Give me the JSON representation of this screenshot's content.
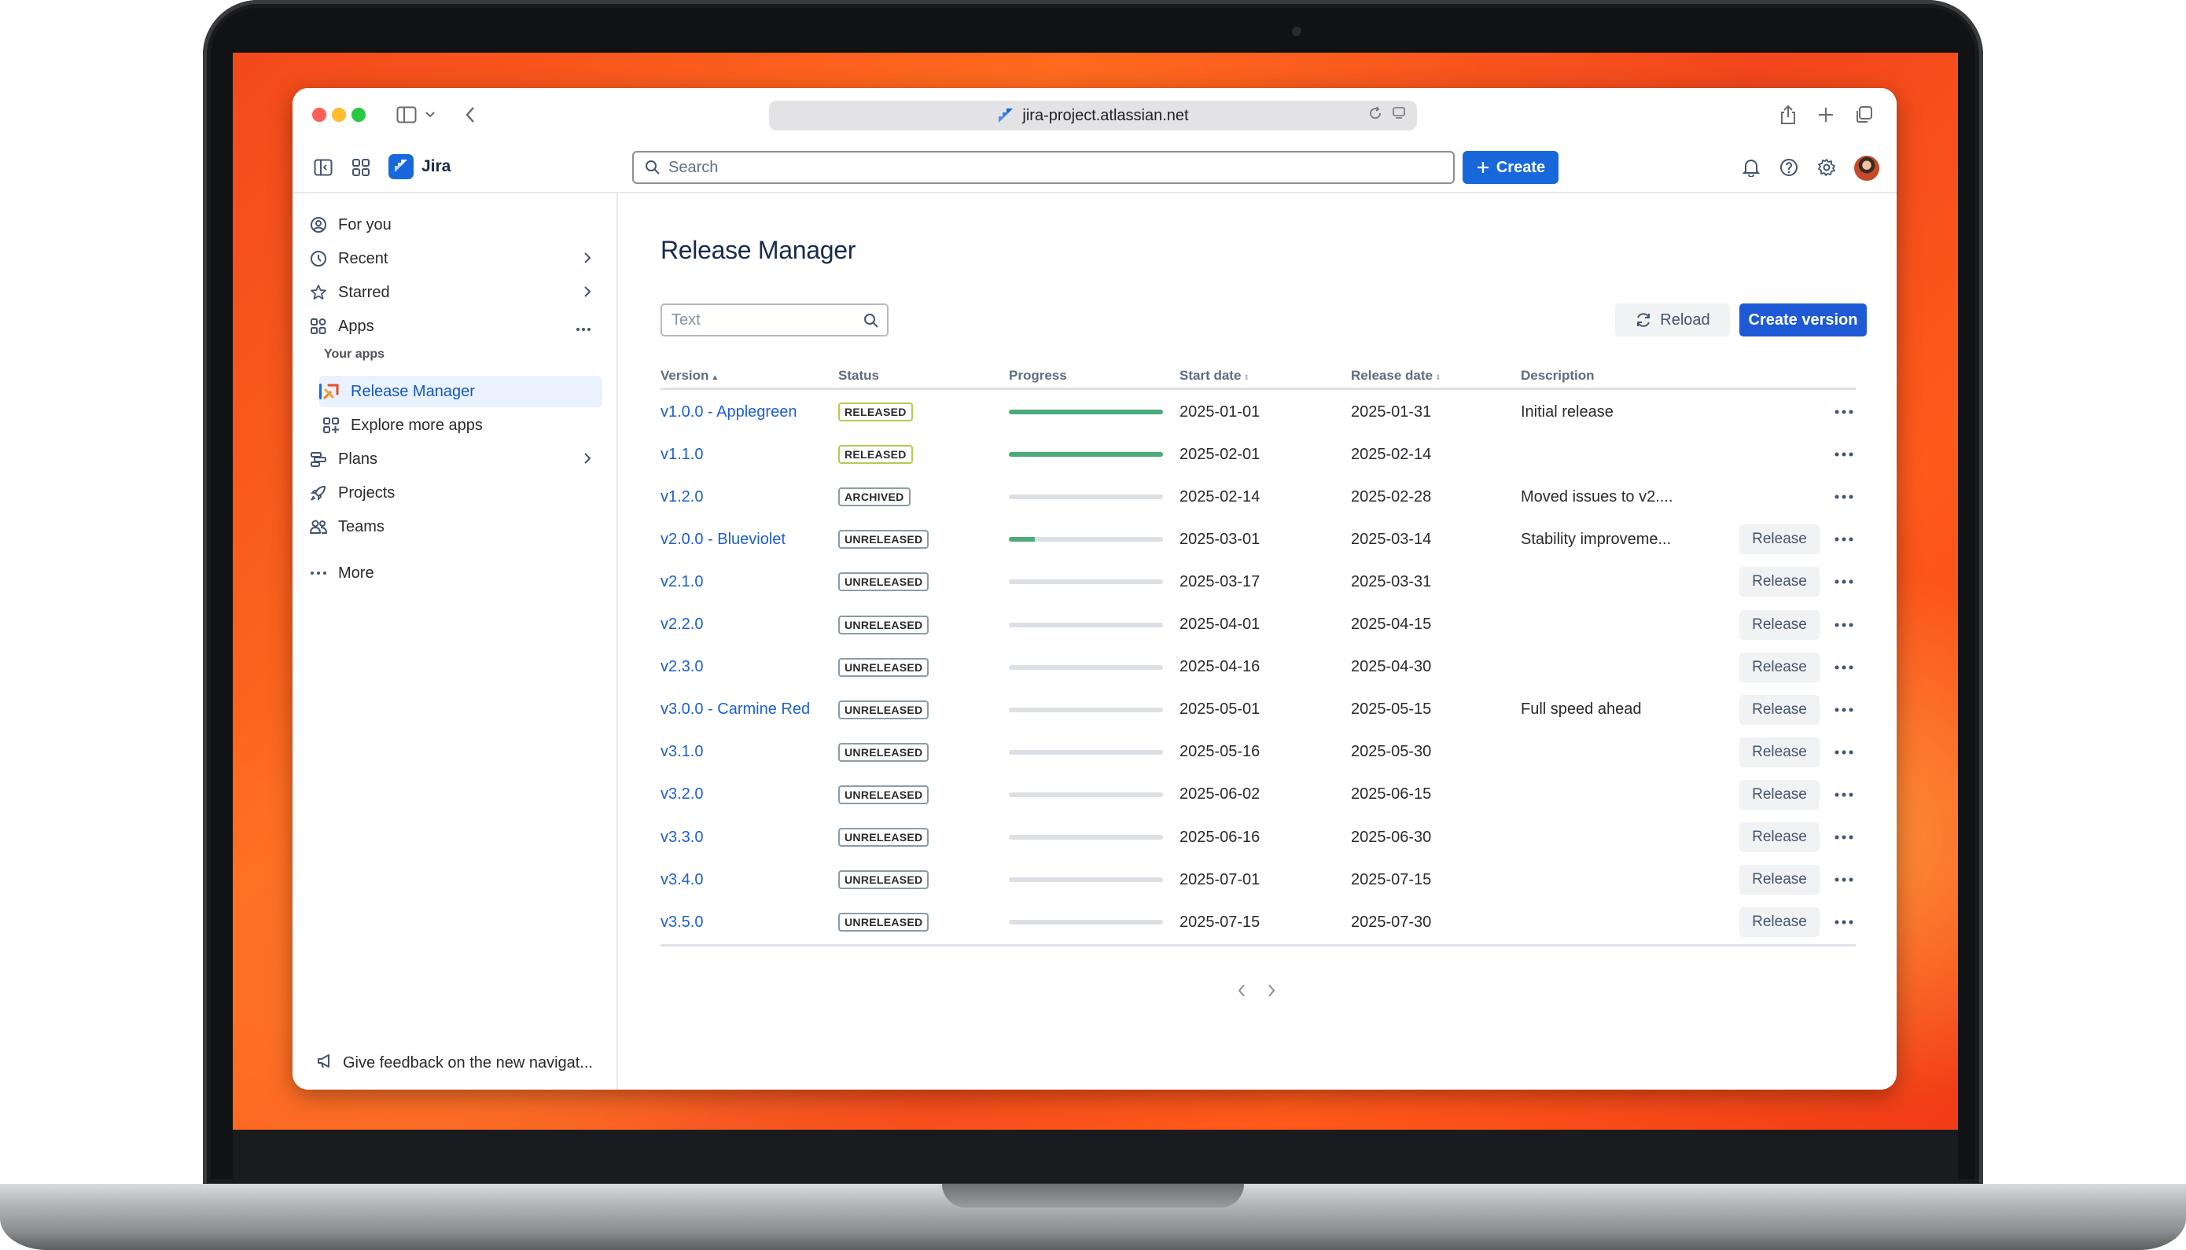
{
  "browser": {
    "url": "jira-project.atlassian.net"
  },
  "header": {
    "app_name": "Jira",
    "search_placeholder": "Search",
    "create_label": "Create"
  },
  "sidebar": {
    "items": [
      {
        "label": "For you",
        "icon": "user-circle-icon"
      },
      {
        "label": "Recent",
        "icon": "clock-icon"
      },
      {
        "label": "Starred",
        "icon": "star-icon"
      },
      {
        "label": "Apps",
        "icon": "apps-icon"
      }
    ],
    "your_apps_label": "Your apps",
    "app_items": [
      {
        "label": "Release Manager",
        "icon": "release-manager-icon",
        "active": true
      },
      {
        "label": "Explore more apps",
        "icon": "apps-add-icon"
      }
    ],
    "bottom_items": [
      {
        "label": "Plans",
        "icon": "plans-icon"
      },
      {
        "label": "Projects",
        "icon": "rocket-icon"
      },
      {
        "label": "Teams",
        "icon": "teams-icon"
      }
    ],
    "more_label": "More",
    "feedback_label": "Give feedback on the new navigat..."
  },
  "main": {
    "title": "Release Manager",
    "filter_placeholder": "Text",
    "reload_label": "Reload",
    "create_version_label": "Create version",
    "columns": {
      "version": "Version",
      "status": "Status",
      "progress": "Progress",
      "start_date": "Start date",
      "release_date": "Release date",
      "description": "Description"
    },
    "release_button_label": "Release",
    "rows": [
      {
        "version": "v1.0.0 - Applegreen",
        "status": "RELEASED",
        "progress": 1.0,
        "start": "2025-01-01",
        "release": "2025-01-31",
        "description": "Initial release",
        "show_release": false
      },
      {
        "version": "v1.1.0",
        "status": "RELEASED",
        "progress": 1.0,
        "start": "2025-02-01",
        "release": "2025-02-14",
        "description": "",
        "show_release": false
      },
      {
        "version": "v1.2.0",
        "status": "ARCHIVED",
        "progress": 0,
        "start": "2025-02-14",
        "release": "2025-02-28",
        "description": "Moved issues to v2....",
        "show_release": false
      },
      {
        "version": "v2.0.0 - Blueviolet",
        "status": "UNRELEASED",
        "progress": 0.17,
        "start": "2025-03-01",
        "release": "2025-03-14",
        "description": "Stability improveme...",
        "show_release": true
      },
      {
        "version": "v2.1.0",
        "status": "UNRELEASED",
        "progress": 0,
        "start": "2025-03-17",
        "release": "2025-03-31",
        "description": "",
        "show_release": true
      },
      {
        "version": "v2.2.0",
        "status": "UNRELEASED",
        "progress": 0,
        "start": "2025-04-01",
        "release": "2025-04-15",
        "description": "",
        "show_release": true
      },
      {
        "version": "v2.3.0",
        "status": "UNRELEASED",
        "progress": 0,
        "start": "2025-04-16",
        "release": "2025-04-30",
        "description": "",
        "show_release": true
      },
      {
        "version": "v3.0.0 - Carmine Red",
        "status": "UNRELEASED",
        "progress": 0,
        "start": "2025-05-01",
        "release": "2025-05-15",
        "description": "Full speed ahead",
        "show_release": true
      },
      {
        "version": "v3.1.0",
        "status": "UNRELEASED",
        "progress": 0,
        "start": "2025-05-16",
        "release": "2025-05-30",
        "description": "",
        "show_release": true
      },
      {
        "version": "v3.2.0",
        "status": "UNRELEASED",
        "progress": 0,
        "start": "2025-06-02",
        "release": "2025-06-15",
        "description": "",
        "show_release": true
      },
      {
        "version": "v3.3.0",
        "status": "UNRELEASED",
        "progress": 0,
        "start": "2025-06-16",
        "release": "2025-06-30",
        "description": "",
        "show_release": true
      },
      {
        "version": "v3.4.0",
        "status": "UNRELEASED",
        "progress": 0,
        "start": "2025-07-01",
        "release": "2025-07-15",
        "description": "",
        "show_release": true
      },
      {
        "version": "v3.5.0",
        "status": "UNRELEASED",
        "progress": 0,
        "start": "2025-07-15",
        "release": "2025-07-30",
        "description": "",
        "show_release": true
      }
    ]
  },
  "colors": {
    "accent": "#1868db",
    "progress_fill": "#4bac7a",
    "link": "#1c5ed6"
  }
}
